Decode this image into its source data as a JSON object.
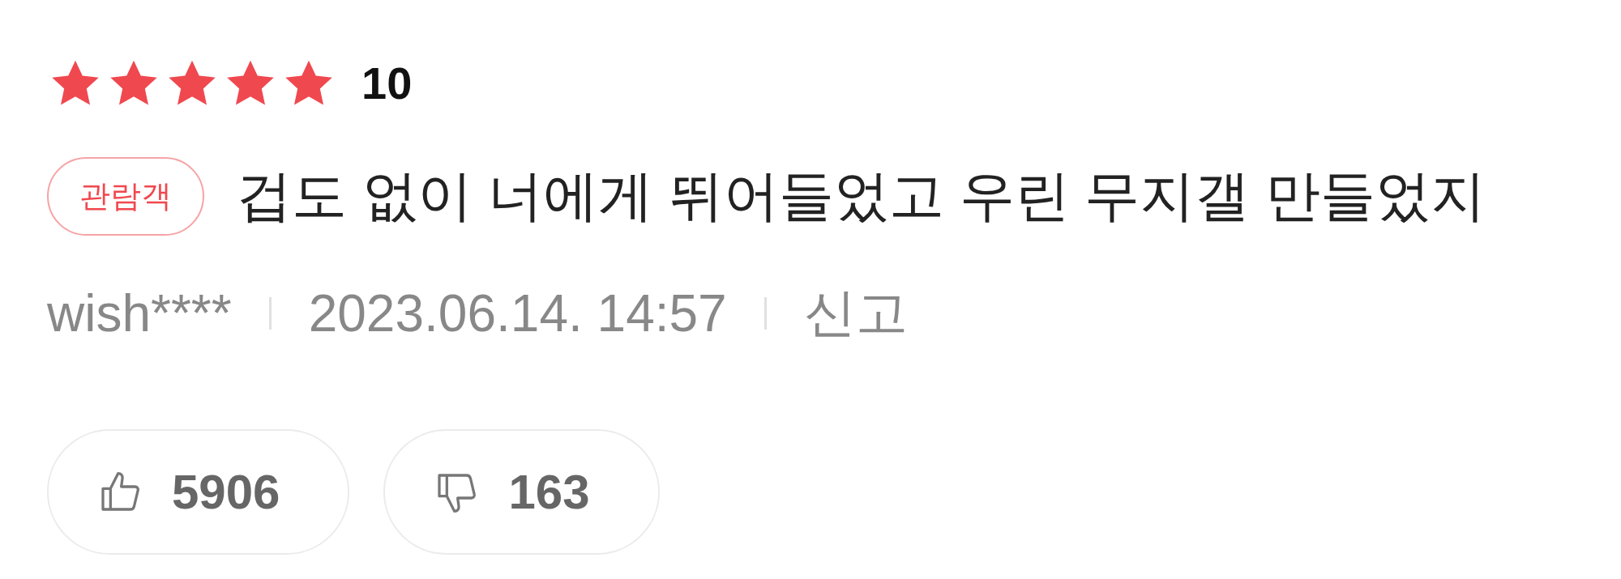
{
  "review": {
    "stars": 5,
    "score": "10",
    "badge": "관람객",
    "text": "겁도 없이 너에게 뛰어들었고 우린 무지갤 만들었지",
    "author": "wish****",
    "date": "2023.06.14. 14:57",
    "report": "신고"
  },
  "buttons": [
    {
      "kind": "like",
      "count": "5906"
    },
    {
      "kind": "dislike",
      "count": "163"
    }
  ]
}
